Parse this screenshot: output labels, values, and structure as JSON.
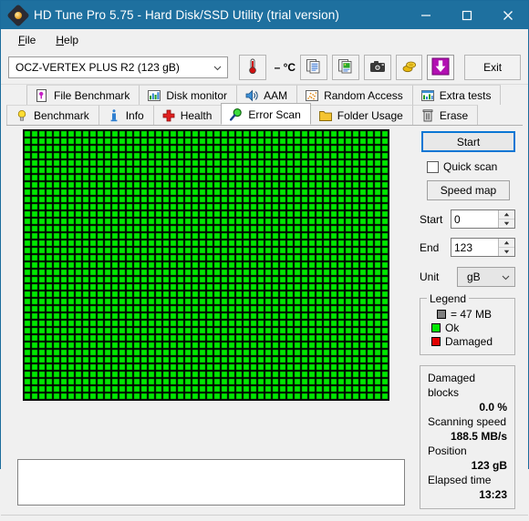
{
  "window": {
    "title": "HD Tune Pro 5.75 - Hard Disk/SSD Utility (trial version)",
    "icon": "harddisk-icon",
    "titlebar_color": "#1e709f",
    "minimize_label": "–",
    "maximize_label": "□",
    "close_label": "✕"
  },
  "menu": {
    "items": [
      {
        "label": "File",
        "accel": "F",
        "rest": "ile"
      },
      {
        "label": "Help",
        "accel": "H",
        "rest": "elp"
      }
    ]
  },
  "toolbar": {
    "drive_selected": "OCZ-VERTEX PLUS R2 (123 gB)",
    "temperature": "– °C",
    "thermometer_icon": "thermometer-icon",
    "buttons": [
      {
        "name": "copy-text-button",
        "icon": "document-copy-icon"
      },
      {
        "name": "copy-image-button",
        "icon": "image-copy-icon"
      },
      {
        "name": "screenshot-button",
        "icon": "camera-icon"
      },
      {
        "name": "settings-button",
        "icon": "gold-coins-icon"
      },
      {
        "name": "save-button",
        "icon": "download-arrow-icon"
      }
    ],
    "exit_label": "Exit"
  },
  "tabs": {
    "row1": [
      {
        "label": "File Benchmark",
        "icon": "file-benchmark-icon",
        "active": false
      },
      {
        "label": "Disk monitor",
        "icon": "bar-chart-icon",
        "active": false
      },
      {
        "label": "AAM",
        "icon": "speaker-icon",
        "active": false
      },
      {
        "label": "Random Access",
        "icon": "scatter-icon",
        "active": false
      },
      {
        "label": "Extra tests",
        "icon": "extra-tests-icon",
        "active": false
      }
    ],
    "row2": [
      {
        "label": "Benchmark",
        "icon": "lightbulb-icon",
        "active": false
      },
      {
        "label": "Info",
        "icon": "info-icon",
        "active": false
      },
      {
        "label": "Health",
        "icon": "red-cross-icon",
        "active": false
      },
      {
        "label": "Error Scan",
        "icon": "magnifier-icon",
        "active": true
      },
      {
        "label": "Folder Usage",
        "icon": "folder-icon",
        "active": false
      },
      {
        "label": "Erase",
        "icon": "trash-icon",
        "active": false
      }
    ]
  },
  "scan_map": {
    "columns": 50,
    "rows": 37,
    "cell_size": 8,
    "block_color": "#00e800",
    "grid_color": "#000000",
    "all_blocks_status": "Ok"
  },
  "log": {
    "text": ""
  },
  "controls": {
    "start_label": "Start",
    "quick_scan_label": "Quick scan",
    "quick_scan_checked": false,
    "speed_map_label": "Speed map",
    "start_field_label": "Start",
    "start_field_value": "0",
    "end_field_label": "End",
    "end_field_value": "123",
    "unit_label": "Unit",
    "unit_value": "gB"
  },
  "legend": {
    "title": "Legend",
    "block_size": "= 47 MB",
    "block_swatch_color": "#7f7f7f",
    "ok_label": "Ok",
    "ok_color": "#00e800",
    "damaged_label": "Damaged",
    "damaged_color": "#e00000"
  },
  "stats": {
    "damaged_blocks_label": "Damaged blocks",
    "damaged_blocks_value": "0.0 %",
    "scanning_speed_label": "Scanning speed",
    "scanning_speed_value": "188.5 MB/s",
    "position_label": "Position",
    "position_value": "123 gB",
    "elapsed_time_label": "Elapsed time",
    "elapsed_time_value": "13:23"
  }
}
